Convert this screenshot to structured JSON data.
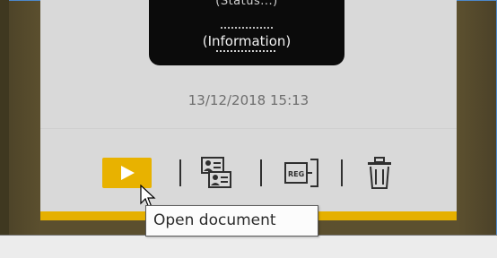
{
  "document_card": {
    "preview": {
      "top_text": "(Status...)",
      "info_text": "(Information)"
    },
    "date": "13/12/2018 15:13",
    "actions": {
      "play_icon": "play-icon",
      "id_cards_icon": "id-cards-icon",
      "register_icon": "register-icon",
      "trash_icon": "trash-icon"
    }
  },
  "tooltip": {
    "text": "Open document"
  },
  "colors": {
    "accent": "#e5b000",
    "card_background": "#d9d9d9",
    "preview_background": "#0b0b0b",
    "window_background": "#5c502f",
    "frame_border": "#4d88c9"
  }
}
